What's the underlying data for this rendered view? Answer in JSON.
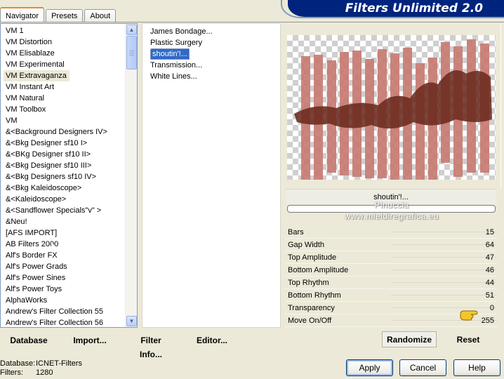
{
  "tabs": [
    {
      "label": "Navigator",
      "active": true
    },
    {
      "label": "Presets",
      "active": false
    },
    {
      "label": "About",
      "active": false
    }
  ],
  "window_title": "Filters Unlimited 2.0",
  "categories": {
    "selected": "VM Extravaganza",
    "items": [
      "VM 1",
      "VM Distortion",
      "VM Elisablaze",
      "VM Experimental",
      "VM Extravaganza",
      "VM Instant Art",
      "VM Natural",
      "VM Toolbox",
      "VM",
      "&<Background Designers IV>",
      "&<Bkg Designer sf10 I>",
      "&<BKg Designer sf10 II>",
      "&<Bkg Designer sf10 III>",
      "&<Bkg Designers sf10 IV>",
      "&<Bkg Kaleidoscope>",
      "&<Kaleidoscope>",
      "&<Sandflower Specials\"v\" >",
      "&Neu!",
      "[AFS IMPORT]",
      "AB Filters 2000",
      "Alf's Border FX",
      "Alf's Power Grads",
      "Alf's Power Sines",
      "Alf's Power Toys",
      "AlphaWorks",
      "Andrew's Filter Collection 55",
      "Andrew's Filter Collection 56"
    ]
  },
  "filters": {
    "selected": "shoutin'!...",
    "items": [
      "James Bondage...",
      "Plastic Surgery",
      "shoutin'!...",
      "Transmission...",
      "White Lines..."
    ]
  },
  "preview": {
    "filter_name": "shoutin'!...",
    "watermark_lines": [
      "Pinuccia",
      "www.mieldiregrafica.eu"
    ],
    "bar_color": "#c87b72",
    "silhouette_color": "#6b2a1e"
  },
  "parameters": [
    {
      "name": "Bars",
      "value": "15"
    },
    {
      "name": "Gap Width",
      "value": "64"
    },
    {
      "name": "Top Amplitude",
      "value": "47"
    },
    {
      "name": "Bottom Amplitude",
      "value": "46"
    },
    {
      "name": "Top Rhythm",
      "value": "44"
    },
    {
      "name": "Bottom Rhythm",
      "value": "51"
    },
    {
      "name": "Transparency",
      "value": "0"
    },
    {
      "name": "Move On/Off",
      "value": "255"
    }
  ],
  "toolbar": {
    "database": "Database",
    "import": "Import...",
    "filter_info": "Filter Info...",
    "editor": "Editor...",
    "randomize": "Randomize",
    "reset": "Reset"
  },
  "status": {
    "database_label": "Database:",
    "database_value": "ICNET-Filters",
    "filters_label": "Filters:",
    "filters_value": "1280"
  },
  "dialog_buttons": {
    "apply": "Apply",
    "cancel": "Cancel",
    "help": "Help"
  }
}
